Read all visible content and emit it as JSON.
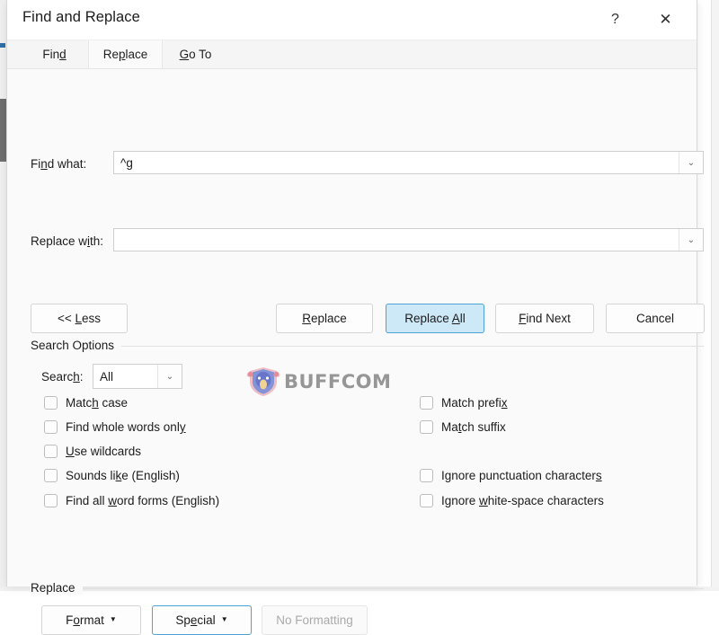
{
  "window": {
    "title": "Find and Replace",
    "help_icon": "question-mark-icon",
    "help_label": "?",
    "close_icon": "close-icon",
    "close_label": "✕"
  },
  "tabs": [
    {
      "label": "Find",
      "accel": "d",
      "active": false
    },
    {
      "label": "Replace",
      "accel": "p",
      "active": true
    },
    {
      "label": "Go To",
      "accel": "G",
      "active": false
    }
  ],
  "fields": {
    "find": {
      "label": "Find what:",
      "accel": "n",
      "value": "^g",
      "placeholder": "",
      "chevron": "⌄"
    },
    "replace": {
      "label": "Replace with:",
      "accel": "i",
      "value": "",
      "placeholder": "",
      "chevron": "⌄"
    }
  },
  "buttons": {
    "less": {
      "label": "<< Less",
      "accel": "L",
      "state": "normal"
    },
    "replace": {
      "label": "Replace",
      "accel": "R",
      "state": "normal"
    },
    "replace_all": {
      "label": "Replace All",
      "accel": "A",
      "state": "default"
    },
    "find_next": {
      "label": "Find Next",
      "accel": "F",
      "state": "normal"
    },
    "cancel": {
      "label": "Cancel",
      "accel": "",
      "state": "normal"
    },
    "format": {
      "label": "Format",
      "accel": "o",
      "state": "normal",
      "caret": "▼"
    },
    "special": {
      "label": "Special",
      "accel": "e",
      "state": "focused",
      "caret": "▼"
    },
    "no_format": {
      "label": "No Formatting",
      "accel": "",
      "state": "disabled"
    }
  },
  "search_options": {
    "group_label": "Search Options",
    "search_label": "Search:",
    "search_accel": "h",
    "search_value": "All",
    "search_chevron": "⌄",
    "left_checkboxes": [
      {
        "label": "Find whole words only",
        "accel": "y",
        "checked": false
      },
      {
        "label": "Match case",
        "accel": "h",
        "checked": false
      },
      {
        "label": "Use wildcards",
        "accel": "U",
        "checked": false
      },
      {
        "label": "Sounds like (English)",
        "accel": "k",
        "checked": false
      },
      {
        "label": "Find all word forms (English)",
        "accel": "w",
        "checked": false
      }
    ],
    "right_checkboxes": [
      {
        "label": "Match prefix",
        "accel": "x",
        "checked": false
      },
      {
        "label": "Match suffix",
        "accel": "t",
        "checked": false
      },
      {
        "label": "Ignore punctuation characters",
        "accel": "s",
        "checked": false
      },
      {
        "label": "Ignore white-space characters",
        "accel": "w",
        "checked": false
      }
    ]
  },
  "replace_group": {
    "group_label": "Replace"
  },
  "watermark": {
    "text": "BUFFCOM",
    "icon": "buffalo-shield-logo-icon",
    "text_color": "#8e8e8e",
    "shield_color": "#6f7fd0",
    "horn_color": "#e87f8d"
  },
  "colors": {
    "accent": "#4da3d6",
    "default_button_fill": "#cde8f7",
    "dialog_bg": "#fafafa",
    "titlebar_bg": "#ffffff",
    "text": "#1c1c1c",
    "disabled_text": "#aaaaaa"
  }
}
